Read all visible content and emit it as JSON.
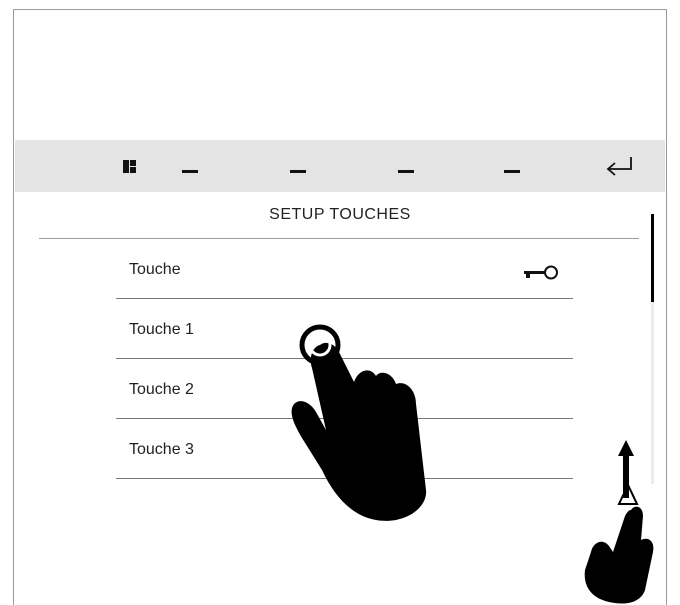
{
  "toolbar": {
    "items": [
      {
        "name": "menu-grid-icon"
      },
      {
        "name": "dash-1-icon"
      },
      {
        "name": "dash-2-icon"
      },
      {
        "name": "dash-3-icon"
      },
      {
        "name": "dash-4-icon"
      },
      {
        "name": "return-arrow-icon"
      }
    ]
  },
  "screen": {
    "title": "SETUP TOUCHES"
  },
  "list": {
    "rows": [
      {
        "label": "Touche",
        "icon": "key-icon"
      },
      {
        "label": "Touche 1"
      },
      {
        "label": "Touche 2"
      },
      {
        "label": "Touche 3"
      }
    ]
  },
  "gestures": {
    "tap": "hand-tap-icon",
    "scroll": "hand-scroll-icon"
  }
}
